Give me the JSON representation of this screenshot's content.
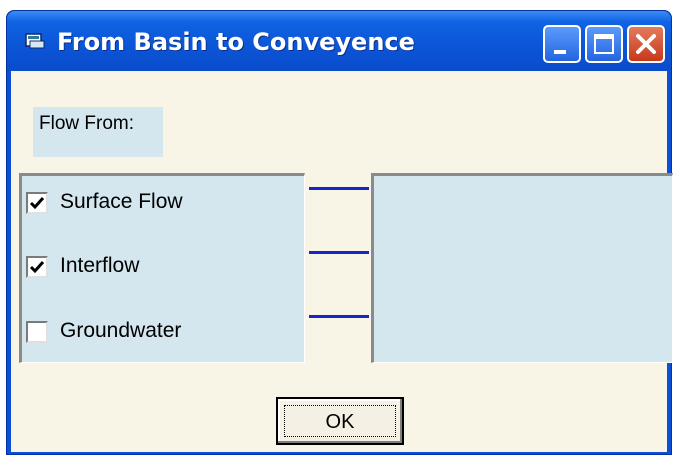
{
  "window": {
    "title": "From Basin to Conveyence",
    "buttons": {
      "minimize": "minimize-icon",
      "maximize": "maximize-icon",
      "close": "close-icon"
    }
  },
  "flow_from": {
    "label": "Flow From:"
  },
  "options": [
    {
      "label": "Surface Flow",
      "checked": true
    },
    {
      "label": "Interflow",
      "checked": true
    },
    {
      "label": "Groundwater",
      "checked": false
    }
  ],
  "ok_button": {
    "label": "OK"
  },
  "colors": {
    "titlebar": "#0b55d6",
    "panel": "#d4e6ee",
    "client": "#f8f4e6",
    "connector": "#1525c8"
  }
}
